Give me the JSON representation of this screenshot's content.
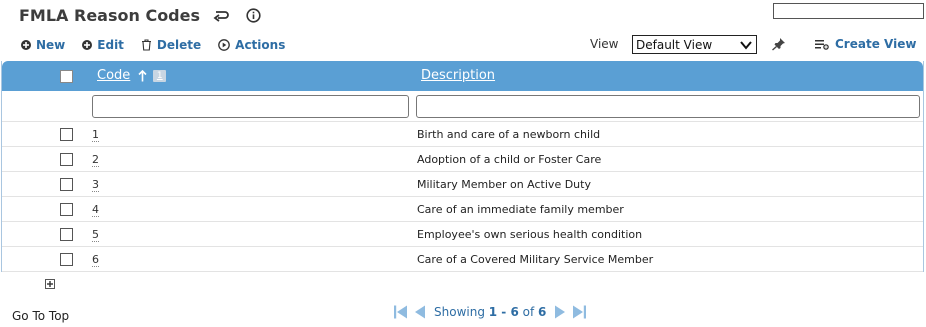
{
  "page": {
    "title": "FMLA Reason Codes"
  },
  "toolbar": {
    "new_label": "New",
    "edit_label": "Edit",
    "delete_label": "Delete",
    "actions_label": "Actions",
    "view_label": "View",
    "view_selected": "Default View",
    "create_view_label": "Create View"
  },
  "grid": {
    "columns": [
      {
        "key": "code",
        "label": "Code",
        "sorted": "ascending",
        "sort_order": "1"
      },
      {
        "key": "description",
        "label": "Description"
      }
    ],
    "rows": [
      {
        "code": "1",
        "description": "Birth and care of a newborn child"
      },
      {
        "code": "2",
        "description": "Adoption of a child or Foster Care"
      },
      {
        "code": "3",
        "description": "Military Member on Active Duty"
      },
      {
        "code": "4",
        "description": "Care of an immediate family member"
      },
      {
        "code": "5",
        "description": "Employee's own serious health condition"
      },
      {
        "code": "6",
        "description": "Care of a Covered Military Service Member"
      }
    ]
  },
  "footer": {
    "go_top_label": "Go To Top",
    "showing_prefix": "Showing",
    "range": "1 - 6",
    "of_label": "of",
    "total": "6"
  },
  "colors": {
    "header_bg": "#5a9fd4",
    "link": "#2e6da4",
    "pager_arrow": "#8fbbe0"
  },
  "icons": [
    "back-arrow-icon",
    "info-icon",
    "plus-circle-icon",
    "trash-icon",
    "play-circle-icon",
    "pin-icon",
    "create-view-icon",
    "sort-up-icon",
    "add-row-icon",
    "first-page-icon",
    "prev-page-icon",
    "next-page-icon",
    "last-page-icon"
  ]
}
